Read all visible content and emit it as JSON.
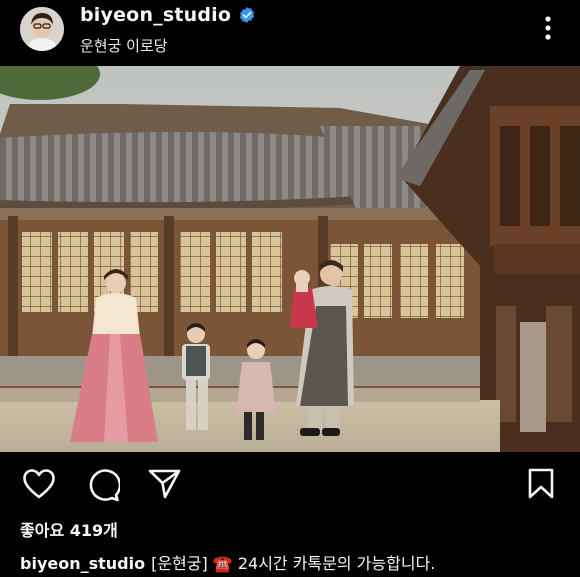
{
  "post": {
    "username": "biyeon_studio",
    "verified": true,
    "location": "운현궁 이로당",
    "photo_alt": "운현궁 이로당",
    "likes_label": "좋아요 419개",
    "caption_user": "biyeon_studio",
    "caption_text": "[운현궁] ☎️ 24시간 카톡문의 가능합니다."
  },
  "colors": {
    "background": "#000000",
    "text": "#f5f5f5",
    "verified_blue": "#3797f0"
  },
  "icons": {
    "more": "more-vertical-icon",
    "like": "heart-icon",
    "comment": "comment-icon",
    "share": "send-icon",
    "save": "bookmark-icon",
    "verified": "verified-badge-icon"
  }
}
